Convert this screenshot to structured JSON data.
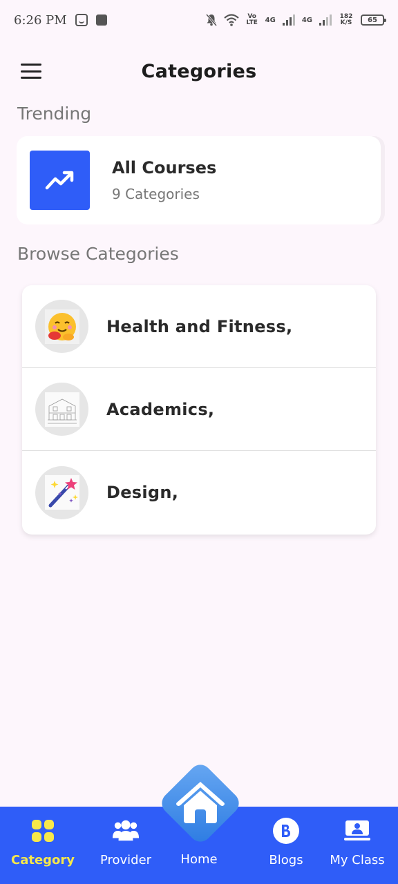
{
  "status_bar": {
    "time": "6:26 PM",
    "net_1": "Vo LTE",
    "net_2": "4G",
    "net_3": "4G",
    "speed": "182 K/S",
    "battery": "65"
  },
  "app_bar": {
    "title": "Categories"
  },
  "trending": {
    "heading": "Trending",
    "card": {
      "title": "All Courses",
      "subtitle": "9 Categories",
      "icon": "trending-up-icon",
      "color": "#2f5df8"
    }
  },
  "browse": {
    "heading": "Browse Categories",
    "items": [
      {
        "label": "Health and Fitness,",
        "icon": "hugging-emoji-icon"
      },
      {
        "label": "Academics,",
        "icon": "building-sketch-icon"
      },
      {
        "label": "Design,",
        "icon": "magic-wand-icon"
      }
    ]
  },
  "bottom_nav": {
    "color": "#2f5df8",
    "active_color": "#f7e84a",
    "items": [
      {
        "label": "Category",
        "icon": "grid-icon"
      },
      {
        "label": "Provider",
        "icon": "people-icon"
      },
      {
        "label": "Home",
        "icon": "home-icon"
      },
      {
        "label": "Blogs",
        "icon": "blogger-icon"
      },
      {
        "label": "My Class",
        "icon": "class-icon"
      }
    ]
  }
}
